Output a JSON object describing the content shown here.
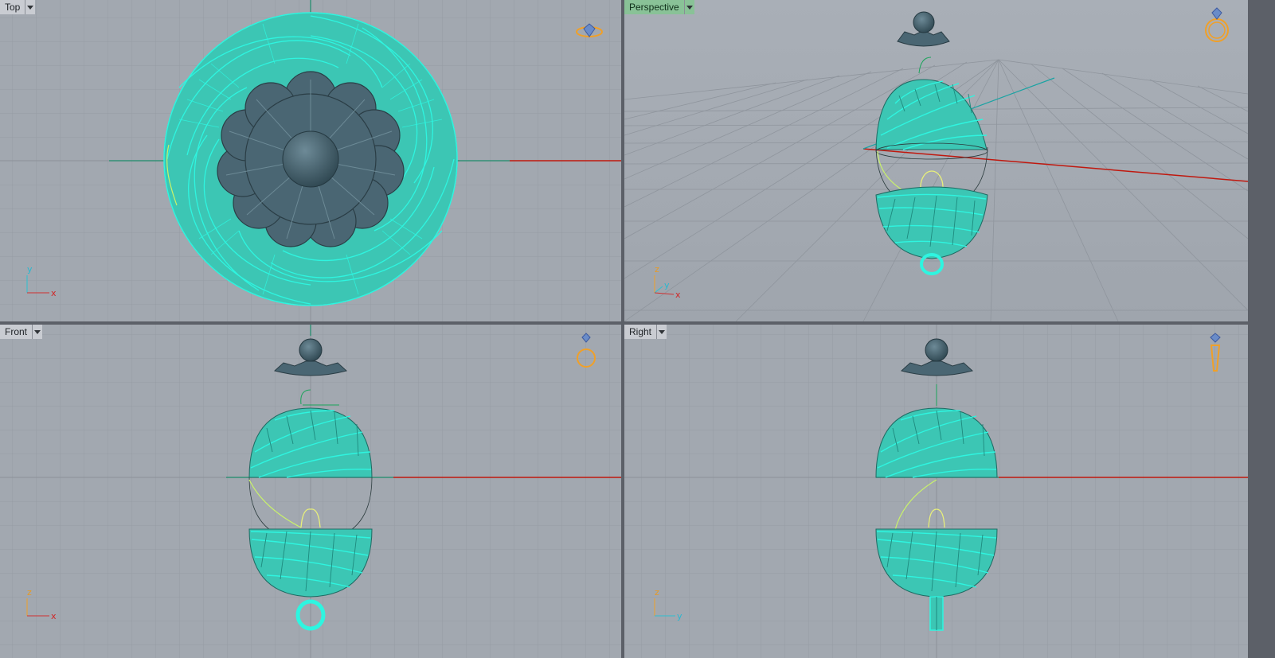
{
  "viewports": {
    "top": {
      "label": "Top",
      "active": false
    },
    "perspective": {
      "label": "Perspective",
      "active": true
    },
    "front": {
      "label": "Front",
      "active": false
    },
    "right": {
      "label": "Right",
      "active": false
    }
  },
  "axes": {
    "top": {
      "a": "y",
      "b": "x"
    },
    "perspective": {
      "a": "z",
      "b": "y",
      "c": "x"
    },
    "front": {
      "a": "z",
      "b": "x"
    },
    "right": {
      "a": "z",
      "b": "y"
    }
  },
  "icons": {
    "view_widget": "ring-preview-icon",
    "menu": "dropdown-arrow-icon"
  },
  "colors": {
    "background": "#a2a8b0",
    "grid_minor": "#979da5",
    "grid_major": "#8b9199",
    "x_axis": "#c0180e",
    "y_axis": "#1d8c6a",
    "object_fill": "#3cc6b4",
    "object_wire": "#2ef5e0",
    "cap": "#4a6673",
    "active_tab": "#89c297"
  }
}
